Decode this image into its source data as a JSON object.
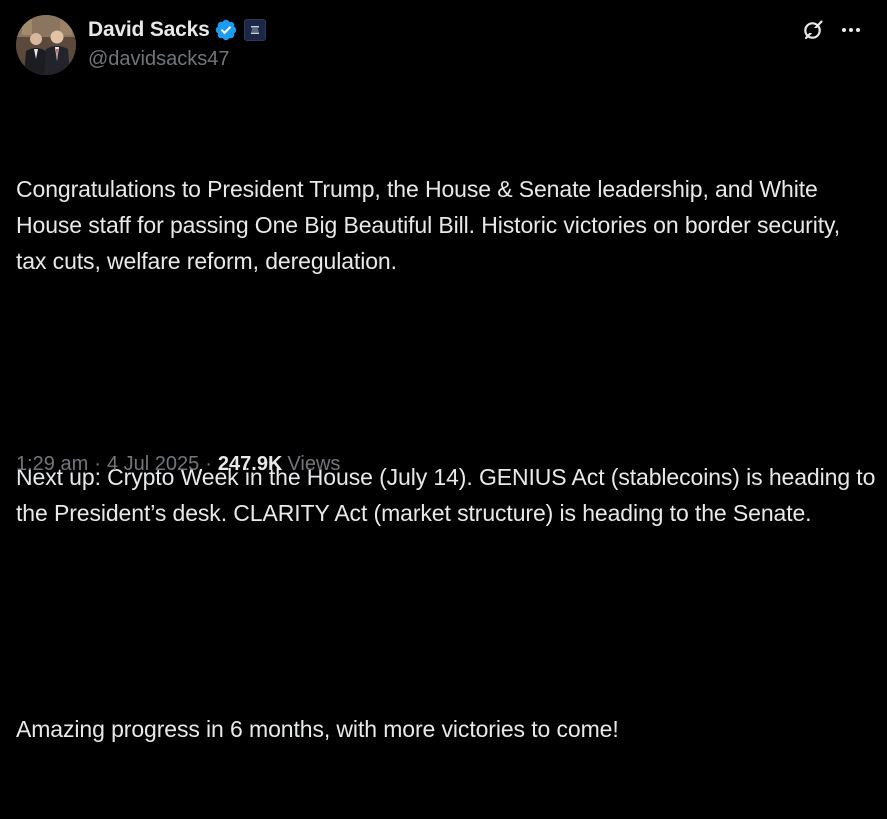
{
  "author": {
    "display_name": "David Sacks",
    "handle": "@davidsacks47",
    "verified": true,
    "affiliate_badge": "org-badge"
  },
  "header": {
    "grok_icon": "grok-icon",
    "more_icon": "more-icon"
  },
  "tweet": {
    "paragraph_1": "Congratulations to President Trump, the House & Senate leadership, and White House staff for passing One Big Beautiful Bill. Historic victories on border security, tax cuts, welfare reform, deregulation.",
    "paragraph_2": "Next up: Crypto Week in the House (July 14). GENIUS Act (stablecoins) is heading to the President’s desk. CLARITY Act (market structure) is heading to the Senate.",
    "paragraph_3": "Amazing progress in 6 months, with more victories to come!"
  },
  "meta": {
    "time": "1:29 am",
    "date": "4 Jul 2025",
    "separator": "·",
    "views_count": "247.9K",
    "views_label": "Views"
  },
  "colors": {
    "background": "#000000",
    "text_primary": "#e7e9ea",
    "text_secondary": "#71767b",
    "verified_blue": "#1d9bf0"
  }
}
